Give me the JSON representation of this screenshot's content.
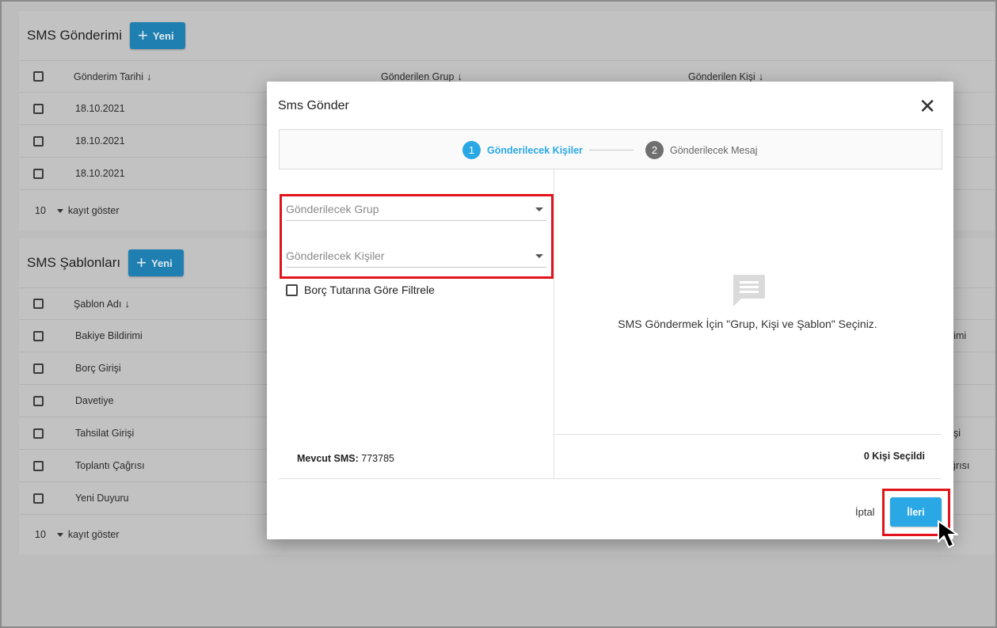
{
  "sms_sending": {
    "title": "SMS Gönderimi",
    "new_label": "Yeni",
    "columns": [
      "Gönderim Tarihi",
      "Gönderilen Grup",
      "Gönderilen Kişi"
    ],
    "rows": [
      {
        "date": "18.10.2021"
      },
      {
        "date": "18.10.2021"
      },
      {
        "date": "18.10.2021"
      }
    ],
    "page_size": "10",
    "page_size_label": "kayıt göster"
  },
  "sms_templates": {
    "title": "SMS Şablonları",
    "new_label": "Yeni",
    "columns": [
      "Şablon Adı"
    ],
    "rows": [
      {
        "name": "Bakiye Bildirimi"
      },
      {
        "name": "Borç Girişi"
      },
      {
        "name": "Davetiye"
      },
      {
        "name": "Tahsilat Girişi"
      },
      {
        "name": "Toplantı Çağrısı"
      },
      {
        "name": "Yeni Duyuru"
      }
    ],
    "right_fragments": [
      "rimi",
      "şi",
      "ğrısı"
    ],
    "page_size": "10",
    "page_size_label": "kayıt göster"
  },
  "modal": {
    "title": "Sms Gönder",
    "steps": [
      {
        "number": "1",
        "label": "Gönderilecek Kişiler"
      },
      {
        "number": "2",
        "label": "Gönderilecek Mesaj"
      }
    ],
    "group_placeholder": "Gönderilecek Grup",
    "contacts_placeholder": "Gönderilecek Kişiler",
    "filter_label": "Borç Tutarına Göre Filtrele",
    "sms_balance_label": "Mevcut SMS:",
    "sms_balance_value": "773785",
    "empty_message": "SMS Göndermek İçin \"Grup, Kişi ve Şablon\" Seçiniz.",
    "selected_count": "0 Kişi Seçildi",
    "cancel_label": "İptal",
    "next_label": "İleri"
  },
  "colors": {
    "accent": "#2aa8e6",
    "highlight": "#e0141a"
  },
  "icons": [
    "plus-icon",
    "sort-arrow-icon",
    "caret-down-icon",
    "close-icon",
    "message-icon",
    "cursor-icon"
  ]
}
